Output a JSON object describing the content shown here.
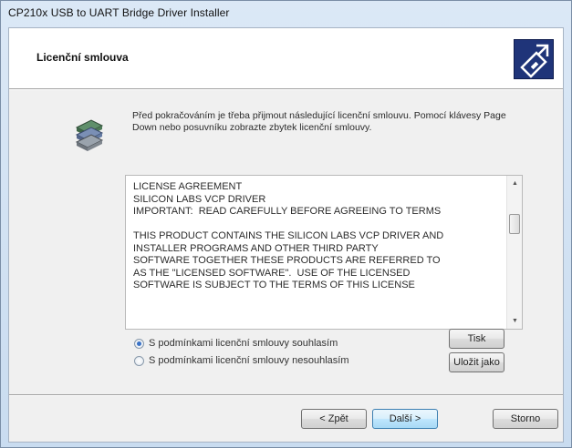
{
  "window": {
    "title": "CP210x USB to UART Bridge Driver Installer"
  },
  "header": {
    "title": "Licenční smlouva",
    "icon": "installer-usb-icon"
  },
  "intro": {
    "icon": "installer-disk-icon",
    "text": "Před pokračováním je třeba přijmout následující licenční smlouvu. Pomocí klávesy Page Down nebo posuvníku zobrazte zbytek licenční smlouvy."
  },
  "license": {
    "text": "LICENSE AGREEMENT\nSILICON LABS VCP DRIVER\nIMPORTANT:  READ CAREFULLY BEFORE AGREEING TO TERMS\n\nTHIS PRODUCT CONTAINS THE SILICON LABS VCP DRIVER AND\nINSTALLER PROGRAMS AND OTHER THIRD PARTY\nSOFTWARE TOGETHER THESE PRODUCTS ARE REFERRED TO\nAS THE \"LICENSED SOFTWARE\".  USE OF THE LICENSED\nSOFTWARE IS SUBJECT TO THE TERMS OF THIS LICENSE",
    "scroll_up": "▲",
    "scroll_down": "▼"
  },
  "options": {
    "accept": "S podmínkami licenční smlouvy souhlasím",
    "decline": "S podmínkami licenční smlouvy nesouhlasím",
    "selected": "accept"
  },
  "buttons": {
    "print": "Tisk",
    "save_as": "Uložit jako",
    "back": "< Zpět",
    "next": "Další >",
    "cancel": "Storno"
  }
}
